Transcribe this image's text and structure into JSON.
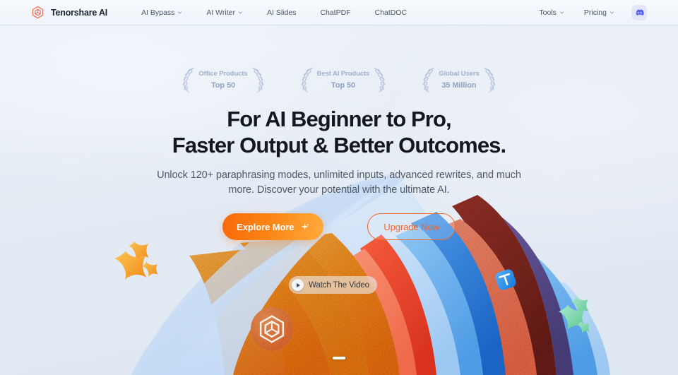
{
  "theme": {
    "page_bg": "#e9eff6",
    "navbar_bg": "#f3f7fb",
    "accent_orange": "#f97814",
    "accent_orange_dark": "#f4652a",
    "headline_color": "#15171c",
    "subhead_color": "#4f5966",
    "badge_color": "#9fb1ce",
    "discord_blue": "#5865f2",
    "discord_bg": "#e3e6fb"
  },
  "navbar": {
    "brand": {
      "name": "Tenorshare AI",
      "logo_icon": "hexagon-logo-icon"
    },
    "links": [
      {
        "label": "AI Bypass",
        "has_dropdown": true,
        "icon": "chevron-down-icon"
      },
      {
        "label": "AI Writer",
        "has_dropdown": true,
        "icon": "chevron-down-icon"
      },
      {
        "label": "AI Slides",
        "has_dropdown": false
      },
      {
        "label": "ChatPDF",
        "has_dropdown": false
      },
      {
        "label": "ChatDOC",
        "has_dropdown": false
      }
    ],
    "right_links": [
      {
        "label": "Tools",
        "has_dropdown": true,
        "icon": "chevron-down-icon"
      },
      {
        "label": "Pricing",
        "has_dropdown": true,
        "icon": "chevron-down-icon"
      }
    ],
    "discord": {
      "icon": "discord-icon",
      "label": "Discord"
    }
  },
  "hero": {
    "badges": [
      {
        "title": "Office Products",
        "value": "Top 50",
        "icon": "laurel-wreath-icon"
      },
      {
        "title": "Best AI Products",
        "value": "Top 50",
        "icon": "laurel-wreath-icon"
      },
      {
        "title": "Global Users",
        "value": "35 Million",
        "icon": "laurel-wreath-icon"
      }
    ],
    "headline_line1": "For AI Beginner to Pro,",
    "headline_line2": "Faster Output & Better Outcomes.",
    "subhead_line1": "Unlock 120+ paraphrasing modes, unlimited inputs, advanced rewrites, and much",
    "subhead_line2": "more. Discover your potential with the ultimate AI.",
    "primary_cta": {
      "label": "Explore More",
      "icon": "sparkle-icon"
    },
    "secondary_cta": {
      "label": "Upgrade Now"
    },
    "watch_video": {
      "label": "Watch The Video",
      "icon": "play-circle-icon"
    },
    "carousel": {
      "active_index": 0,
      "total": 1
    }
  },
  "illustration": {
    "description": "fan of spiraling colored paper ribbons",
    "ribbon_colors": [
      "#f6871f",
      "#fa9e2a",
      "#e8492f",
      "#f4724f",
      "#1f6fd0",
      "#3b8fe0",
      "#8ec2f0",
      "#b8d9f6",
      "#8b2a24",
      "#5b4a8c"
    ],
    "badge_coin": {
      "icon": "hexagon-logo-icon",
      "color": "#f07a3c"
    },
    "floating": [
      {
        "icon": "star-3d-icon",
        "color": "#f6a42a",
        "position": "left"
      },
      {
        "icon": "text-tool-icon",
        "label": "T",
        "color": "#2f96f0",
        "position": "right"
      },
      {
        "icon": "star-3d-icon",
        "color": "#7fd6a3",
        "position": "far-right"
      }
    ]
  }
}
